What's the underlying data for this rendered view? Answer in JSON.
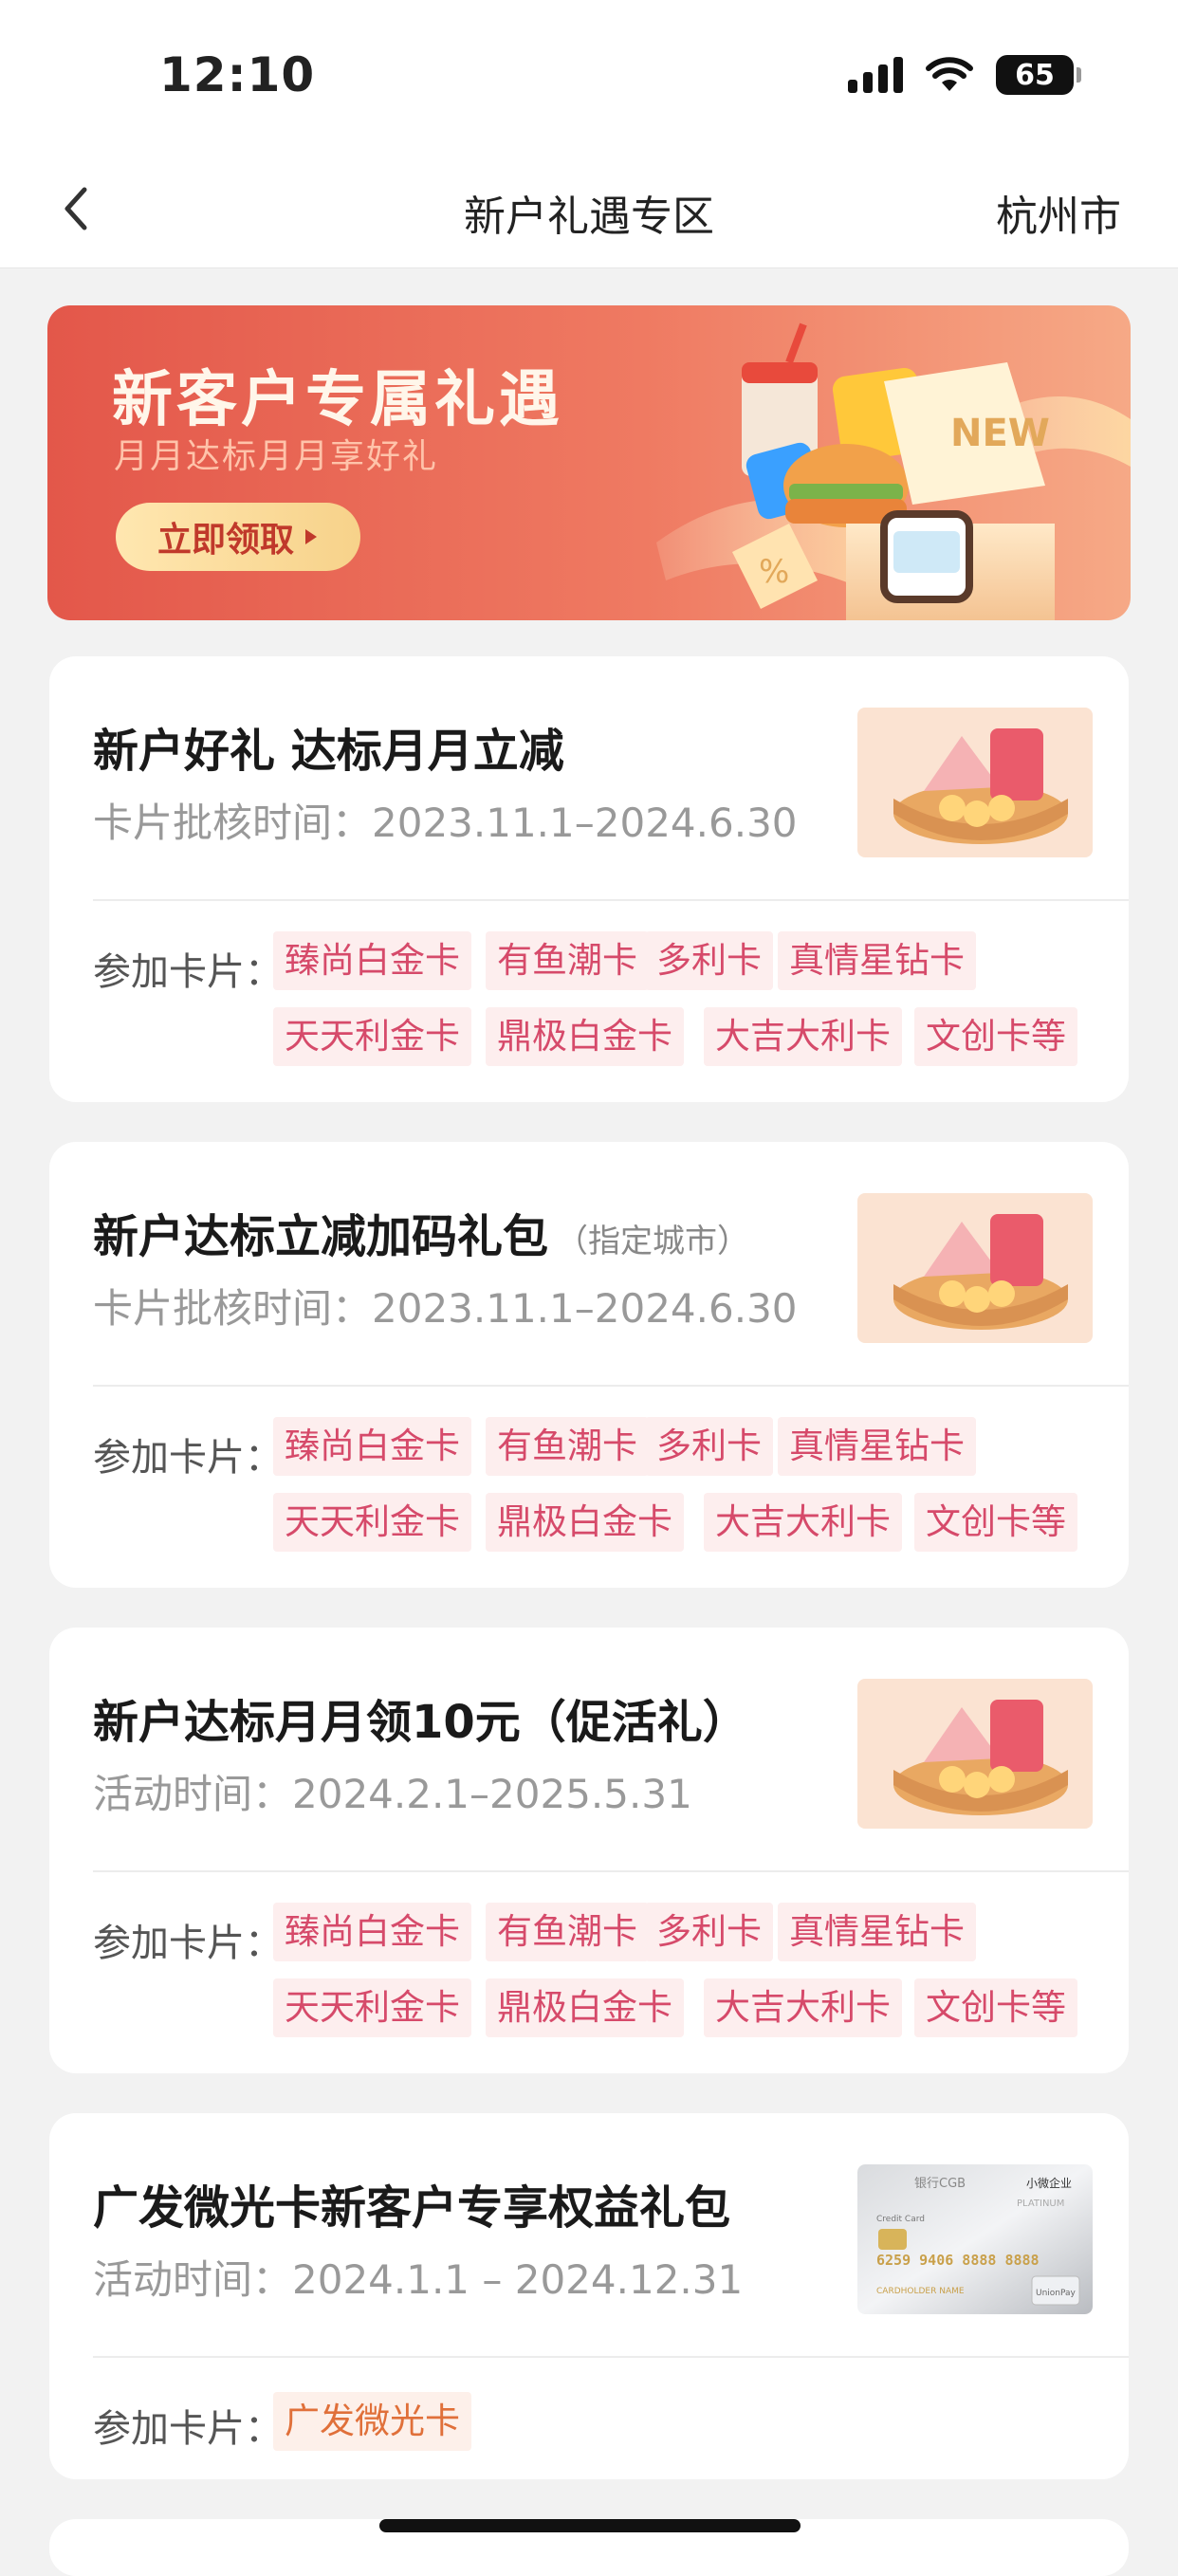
{
  "status": {
    "time": "12:10",
    "battery": "65"
  },
  "nav": {
    "title": "新户礼遇专区",
    "city": "杭州市"
  },
  "banner": {
    "title": "新客户专属礼遇",
    "subtitle": "月月达标月月享好礼",
    "button": "立即领取",
    "badge": "NEW"
  },
  "cards": [
    {
      "title": "新户好礼 达标月月立减",
      "note": "",
      "time": "卡片批核时间：2023.11.1–2024.6.30",
      "label": "参加卡片：",
      "tags": [
        "臻尚白金卡",
        "有鱼潮卡",
        "多利卡",
        "真情星钻卡",
        "天天利金卡",
        "鼎极白金卡",
        "大吉大利卡",
        "文创卡等"
      ]
    },
    {
      "title": "新户达标立减加码礼包",
      "note": "（指定城市）",
      "time": "卡片批核时间：2023.11.1–2024.6.30",
      "label": "参加卡片：",
      "tags": [
        "臻尚白金卡",
        "有鱼潮卡",
        "多利卡",
        "真情星钻卡",
        "天天利金卡",
        "鼎极白金卡",
        "大吉大利卡",
        "文创卡等"
      ]
    },
    {
      "title": "新户达标月月领10元（促活礼）",
      "note": "",
      "time": "活动时间：2024.2.1–2025.5.31",
      "label": "参加卡片：",
      "tags": [
        "臻尚白金卡",
        "有鱼潮卡",
        "多利卡",
        "真情星钻卡",
        "天天利金卡",
        "鼎极白金卡",
        "大吉大利卡",
        "文创卡等"
      ]
    },
    {
      "title": "广发微光卡新客户专享权益礼包",
      "note": "",
      "time": "活动时间：2024.1.1 – 2024.12.31",
      "label": "参加卡片：",
      "tags": [
        "广发微光卡"
      ],
      "card_image": {
        "bank": "银行CGB",
        "corp": "小微企业",
        "platinum": "PLATINUM",
        "credit": "Credit Card",
        "number": "6259 9406 8888 8888",
        "holder": "CARDHOLDER NAME",
        "brand": "UnionPay"
      }
    }
  ]
}
